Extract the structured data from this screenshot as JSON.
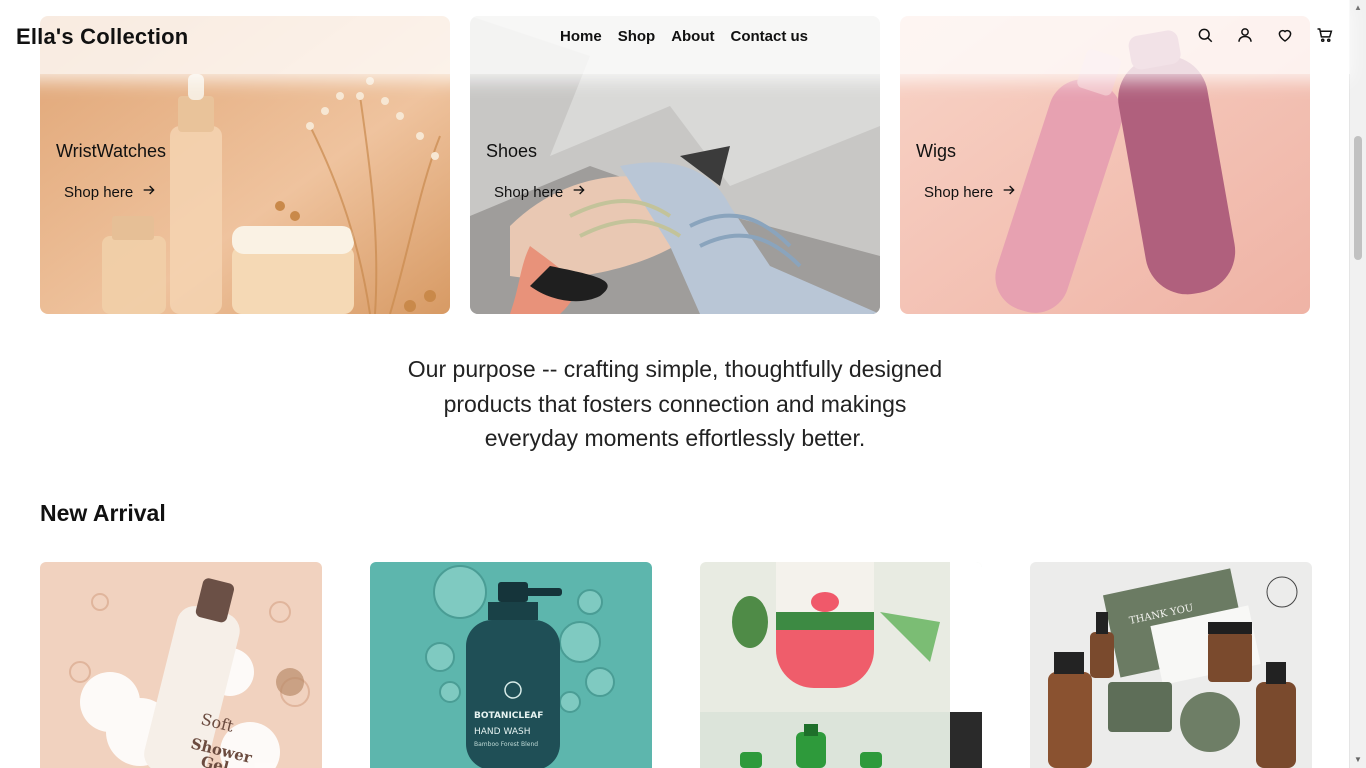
{
  "brand": "Ella's Collection",
  "nav": {
    "items": [
      "Home",
      "Shop",
      "About",
      "Contact us"
    ]
  },
  "header_icons": [
    "search-icon",
    "user-icon",
    "heart-icon",
    "cart-icon"
  ],
  "categories": [
    {
      "title": "WristWatches",
      "link_label": "Shop here"
    },
    {
      "title": "Shoes",
      "link_label": "Shop here"
    },
    {
      "title": "Wigs",
      "link_label": "Shop here"
    }
  ],
  "purpose_text": "Our purpose -- crafting simple, thoughtfully designed products that fosters connection and makings everyday moments effortlessly better.",
  "new_arrival": {
    "title": "New Arrival",
    "products": [
      {
        "name": "shower-gel",
        "image_text": "Soft Shower Gel"
      },
      {
        "name": "hand-wash",
        "image_text": "BOTANICLEAF HAND WASH Bamboo Forest Blend"
      },
      {
        "name": "watermelon-bottle",
        "image_text": ""
      },
      {
        "name": "skincare-set",
        "image_text": "THANK YOU"
      }
    ]
  },
  "colors": {
    "text": "#111111",
    "background": "#ffffff",
    "tile1_bg": "#e9b98b",
    "tile2_bg": "#cfcfcf",
    "tile3_bg": "#f3bfb2",
    "product1_bg": "#f1d2bf",
    "product2_bg": "#5db6ad",
    "product3_bg": "#e8ebe2",
    "product4_bg": "#ececeb"
  }
}
